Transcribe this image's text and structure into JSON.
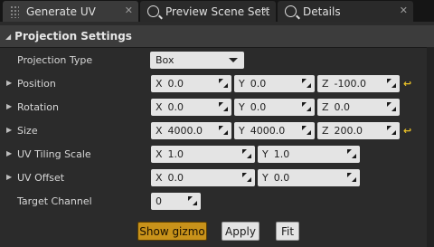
{
  "tabs": [
    {
      "label": "Generate UV",
      "close": "✕"
    },
    {
      "label": "Preview Scene Sett",
      "close": "✕"
    },
    {
      "label": "Details",
      "close": "✕"
    }
  ],
  "section": {
    "title": "Projection Settings"
  },
  "rows": {
    "projection_type": {
      "label": "Projection Type",
      "value": "Box"
    },
    "position": {
      "label": "Position",
      "x": "0.0",
      "y": "0.0",
      "z": "-100.0"
    },
    "rotation": {
      "label": "Rotation",
      "x": "0.0",
      "y": "0.0",
      "z": "0.0"
    },
    "size": {
      "label": "Size",
      "x": "4000.0",
      "y": "4000.0",
      "z": "200.0"
    },
    "uv_tiling": {
      "label": "UV Tiling Scale",
      "x": "1.0",
      "y": "1.0"
    },
    "uv_offset": {
      "label": "UV Offset",
      "x": "0.0",
      "y": "0.0"
    },
    "target_channel": {
      "label": "Target Channel",
      "value": "0"
    }
  },
  "axes": {
    "x": "X",
    "y": "Y",
    "z": "Z"
  },
  "buttons": {
    "show_gizmo": "Show gizmo",
    "apply": "Apply",
    "fit": "Fit"
  },
  "icons": {
    "reset": "↩",
    "expand": "▶",
    "collapse": "◢"
  },
  "colors": {
    "accent": "#c8921a",
    "reset": "#e8c028"
  }
}
